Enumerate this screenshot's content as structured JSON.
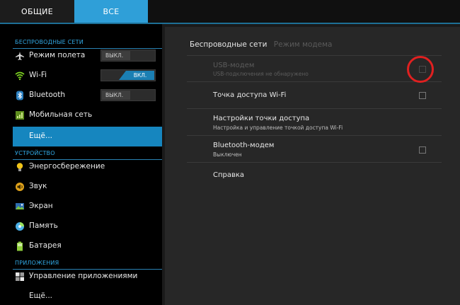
{
  "tabs": [
    {
      "label": "ОБЩИЕ"
    },
    {
      "label": "ВСЕ",
      "selected": true
    }
  ],
  "sidebar": {
    "sections": [
      {
        "title": "БЕСПРОВОДНЫЕ СЕТИ"
      },
      {
        "title": "УСТРОЙСТВО"
      },
      {
        "title": "ПРИЛОЖЕНИЯ"
      }
    ],
    "items": [
      {
        "label": "Режим полета",
        "icon": "airplane-icon",
        "toggle": "ВЫКЛ."
      },
      {
        "label": "Wi-Fi",
        "icon": "wifi-icon",
        "toggle": "ВКЛ."
      },
      {
        "label": "Bluetooth",
        "icon": "bluetooth-icon",
        "toggle": "ВЫКЛ."
      },
      {
        "label": "Мобильная сеть",
        "icon": "mobile-network-icon"
      },
      {
        "label": "Ещё...",
        "selected": true
      },
      {
        "label": "Энергосбережение",
        "icon": "power-saving-icon"
      },
      {
        "label": "Звук",
        "icon": "sound-icon"
      },
      {
        "label": "Экран",
        "icon": "display-icon"
      },
      {
        "label": "Память",
        "icon": "storage-icon"
      },
      {
        "label": "Батарея",
        "icon": "battery-icon"
      },
      {
        "label": "Управление приложениями",
        "icon": "apps-icon"
      },
      {
        "label": "Ещё..."
      }
    ]
  },
  "main": {
    "breadcrumb": [
      "Беспроводные сети",
      "Режим модема"
    ],
    "rows": [
      {
        "title": "USB-модем",
        "sub": "USB-подключения не обнаружено",
        "checkbox": true,
        "checked": false,
        "enabled": false
      },
      {
        "title": "Точка доступа Wi-Fi",
        "checkbox": true,
        "checked": false,
        "enabled": true
      },
      {
        "title": "Настройки точки доступа",
        "sub": "Настройка и управление точкой доступа Wi-Fi",
        "enabled": true
      },
      {
        "title": "Bluetooth-модем",
        "sub": "Выключен",
        "checkbox": true,
        "checked": false,
        "enabled": true
      },
      {
        "title": "Справка",
        "enabled": true
      }
    ]
  },
  "colors": {
    "accent": "#2f9fd8",
    "selected": "#1686bf",
    "section_text": "#32a9e6",
    "highlight_circle": "#e02020"
  }
}
